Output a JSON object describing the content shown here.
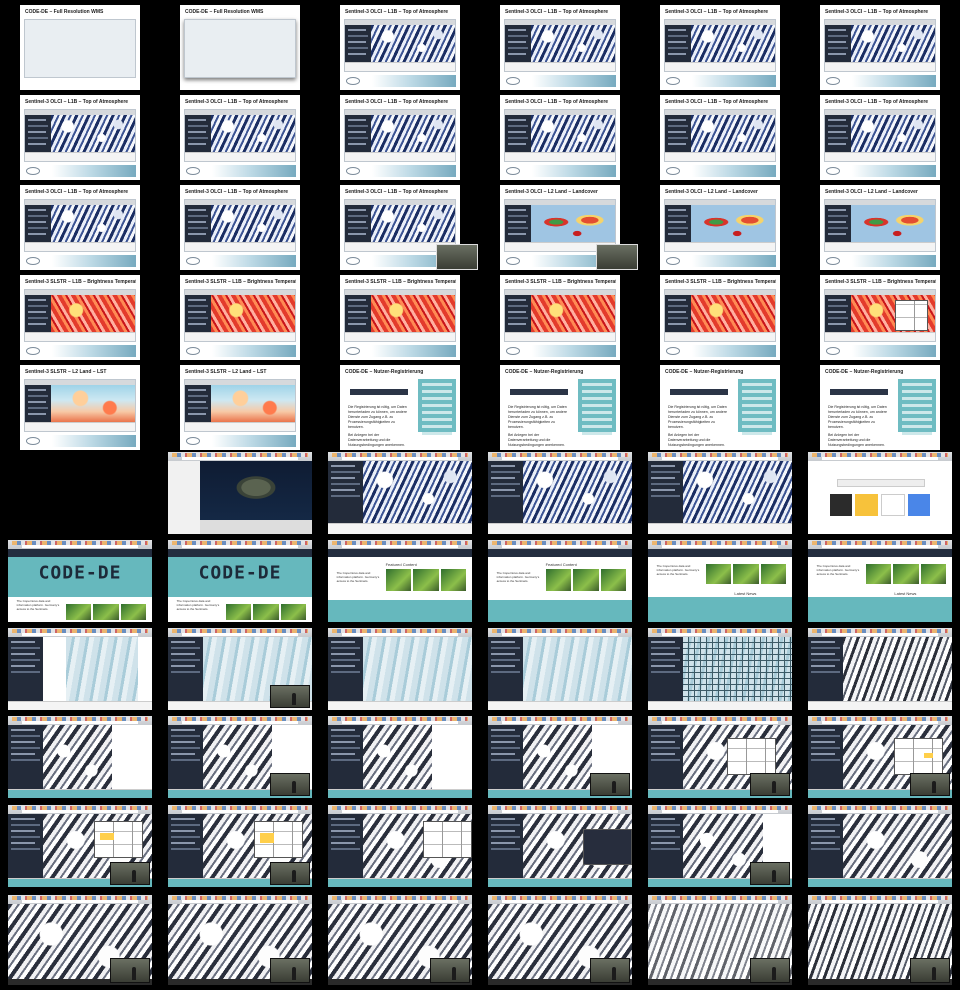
{
  "sheet": {
    "background": "#000000",
    "columns": 6,
    "rows": 11
  },
  "slides": [
    {
      "id": "s1",
      "title": "CODE-DE – Full Resolution WMS",
      "kind": "night"
    },
    {
      "id": "s2",
      "title": "CODE-DE – Full Resolution WMS",
      "kind": "night"
    },
    {
      "id": "s3",
      "title": "Sentinel-3 OLCI – L1B – Top of Atmosphere",
      "kind": "clouds"
    },
    {
      "id": "s4",
      "title": "Sentinel-3 OLCI – L1B – Top of Atmosphere",
      "kind": "clouds"
    },
    {
      "id": "s5",
      "title": "Sentinel-3 OLCI – L1B – Top of Atmosphere",
      "kind": "clouds"
    },
    {
      "id": "s6",
      "title": "Sentinel-3 OLCI – L1B – Top of Atmosphere",
      "kind": "clouds"
    },
    {
      "id": "s7",
      "title": "Sentinel-3 OLCI – L1B – Top of Atmosphere",
      "kind": "clouds"
    },
    {
      "id": "s8",
      "title": "Sentinel-3 OLCI – L1B – Top of Atmosphere",
      "kind": "clouds"
    },
    {
      "id": "s9",
      "title": "Sentinel-3 OLCI – L1B – Top of Atmosphere",
      "kind": "clouds"
    },
    {
      "id": "s10",
      "title": "Sentinel-3 OLCI – L1B – Top of Atmosphere",
      "kind": "clouds"
    },
    {
      "id": "s11",
      "title": "Sentinel-3 OLCI – L1B – Top of Atmosphere",
      "kind": "clouds"
    },
    {
      "id": "s12",
      "title": "Sentinel-3 OLCI – L1B – Top of Atmosphere",
      "kind": "clouds"
    },
    {
      "id": "s13",
      "title": "Sentinel-3 OLCI – L1B – Top of Atmosphere",
      "kind": "clouds"
    },
    {
      "id": "s14",
      "title": "Sentinel-3 OLCI – L1B – Top of Atmosphere",
      "kind": "clouds"
    },
    {
      "id": "s15",
      "title": "Sentinel-3 OLCI – L1B – Top of Atmosphere",
      "kind": "clouds"
    },
    {
      "id": "s16",
      "title": "Sentinel-3 OLCI – L2 Land – Landcover",
      "kind": "land"
    },
    {
      "id": "s17",
      "title": "Sentinel-3 OLCI – L2 Land – Landcover",
      "kind": "land"
    },
    {
      "id": "s18",
      "title": "Sentinel-3 OLCI – L2 Land – Landcover",
      "kind": "land"
    },
    {
      "id": "s19",
      "title": "Sentinel-3 SLSTR – L1B – Brightness Temperature TOA",
      "kind": "heat"
    },
    {
      "id": "s20",
      "title": "Sentinel-3 SLSTR – L1B – Brightness Temperature TOA",
      "kind": "heat"
    },
    {
      "id": "s21",
      "title": "Sentinel-3 SLSTR – L1B – Brightness Temperature TOA",
      "kind": "heat"
    },
    {
      "id": "s22",
      "title": "Sentinel-3 SLSTR – L1B – Brightness Temperature TOA",
      "kind": "heat"
    },
    {
      "id": "s23",
      "title": "Sentinel-3 SLSTR – L1B – Brightness Temperature TOA",
      "kind": "heat"
    },
    {
      "id": "s24",
      "title": "Sentinel-3 SLSTR – L1B – Brightness Temperature TOA",
      "kind": "heat"
    },
    {
      "id": "s25",
      "title": "Sentinel-3 SLSTR – L2 Land – LST",
      "kind": "lst"
    },
    {
      "id": "s26",
      "title": "Sentinel-3 SLSTR – L2 Land – LST",
      "kind": "lst"
    },
    {
      "id": "s27",
      "title": "CODE-DE – Nutzer-Registrierung",
      "kind": "rules"
    },
    {
      "id": "s28",
      "title": "CODE-DE – Nutzer-Registrierung",
      "kind": "rules"
    },
    {
      "id": "s29",
      "title": "CODE-DE – Nutzer-Registrierung",
      "kind": "rules"
    },
    {
      "id": "s30",
      "title": "CODE-DE – Nutzer-Registrierung",
      "kind": "rules"
    }
  ],
  "registration_text": {
    "p1": "Die Registrierung ist nötig, um Daten herunterladen zu können, um andere Dienste zum Zugang z.B. zu Prozessierungsfähigkeiten zu benutzen.",
    "p2": "Bei Anlegen bei der Datenverarbeitung und die Nutzungsbedingungen anerkennen."
  },
  "portal": {
    "logo_text": "CODE-DE",
    "featured_label": "Featured Content",
    "latest_news_label": "Latest News",
    "intro_text": "The Copernicus data and information platform. Germany's access to the Sentinels."
  },
  "colors": {
    "accent": "#66b8bd",
    "navy": "#232d3f",
    "highlight": "#ffcf4a"
  }
}
